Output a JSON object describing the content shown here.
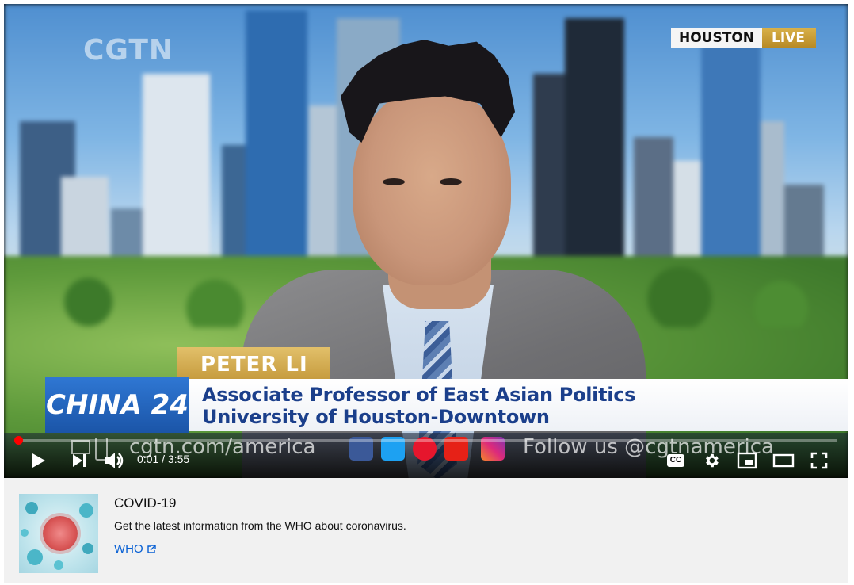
{
  "video": {
    "channel_logo": "CGTN",
    "live_location": "HOUSTON",
    "live_label": "LIVE",
    "guest_name": "PETER LI",
    "guest_title_line1": "Associate Professor of East Asian Politics",
    "guest_title_line2": "University of Houston-Downtown",
    "show_logo": "CHINA 24",
    "ticker_url": "cgtn.com/america",
    "ticker_follow": "Follow us @cgtnamerica",
    "social_icons": [
      "facebook-icon",
      "twitter-icon",
      "weibo-icon",
      "youtube-icon",
      "instagram-icon"
    ]
  },
  "controls": {
    "time": "0:01 / 3:55",
    "progress": 0.004,
    "progress_color": "#ff0000",
    "buttons": [
      "play-icon",
      "next-icon",
      "volume-icon",
      "captions-icon",
      "settings-icon",
      "miniplayer-icon",
      "theater-icon",
      "fullscreen-icon"
    ],
    "captions_label": "CC"
  },
  "info_panel": {
    "title": "COVID-19",
    "description": "Get the latest information from the WHO about coronavirus.",
    "link_label": "WHO",
    "link_color": "#065fd4"
  }
}
